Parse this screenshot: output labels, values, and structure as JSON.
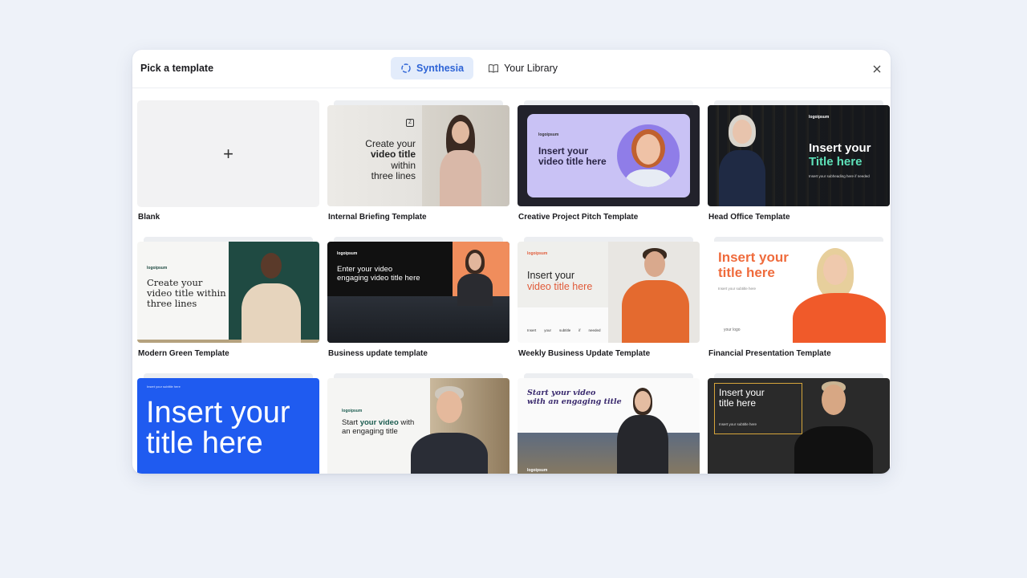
{
  "modal": {
    "title": "Pick a template",
    "tabs": [
      {
        "label": "Synthesia",
        "active": true
      },
      {
        "label": "Your Library",
        "active": false
      }
    ]
  },
  "templates": [
    {
      "label": "Blank",
      "plus": "+"
    },
    {
      "label": "Internal Briefing Template",
      "text_a": "Create your",
      "text_b": "video title",
      "text_c": "within",
      "text_d": "three lines"
    },
    {
      "label": "Creative Project Pitch Template",
      "logo": "logoipsum",
      "text_a": "Insert your",
      "text_b": "video title here"
    },
    {
      "label": "Head Office Template",
      "logo": "logoipsum",
      "text_a": "Insert your",
      "text_b": "Title here",
      "sub": "Insert your subheading here if needed"
    },
    {
      "label": "Modern Green Template",
      "logo": "logoipsum",
      "text_a": "Create your",
      "text_b": "video title within",
      "text_c": "three lines"
    },
    {
      "label": "Business update template",
      "logo": "logoipsum",
      "text_a": "Enter your video",
      "text_b": "engaging video title here"
    },
    {
      "label": "Weekly Business Update Template",
      "logo": "logoipsum",
      "text_a": "Insert your",
      "text_b": "video title here",
      "foot": [
        "Insert",
        "your",
        "subtitle",
        "if",
        "needed"
      ]
    },
    {
      "label": "Financial Presentation Template",
      "text_a": "Insert your",
      "text_b": "title here",
      "sub": "Insert your subtitle here",
      "logo": "your logo"
    },
    {
      "label": "",
      "text_a": "Insert your",
      "text_b": "title here",
      "top": "Insert your subtitle here"
    },
    {
      "label": "",
      "logo": "logoipsum",
      "text_a": "Start",
      "text_b": "your video",
      "text_c": "with",
      "text_d": "an engaging title"
    },
    {
      "label": "",
      "text_a": "Start your video",
      "text_b": "with an engaging title",
      "logo": "logoipsum"
    },
    {
      "label": "",
      "text_a": "Insert your",
      "text_b": "title here",
      "sub": "Insert your subtitle here"
    }
  ],
  "colors": {
    "accent": "#2e64d6",
    "accent_bg": "#e3ecfb",
    "page_bg": "#eef2f9"
  }
}
